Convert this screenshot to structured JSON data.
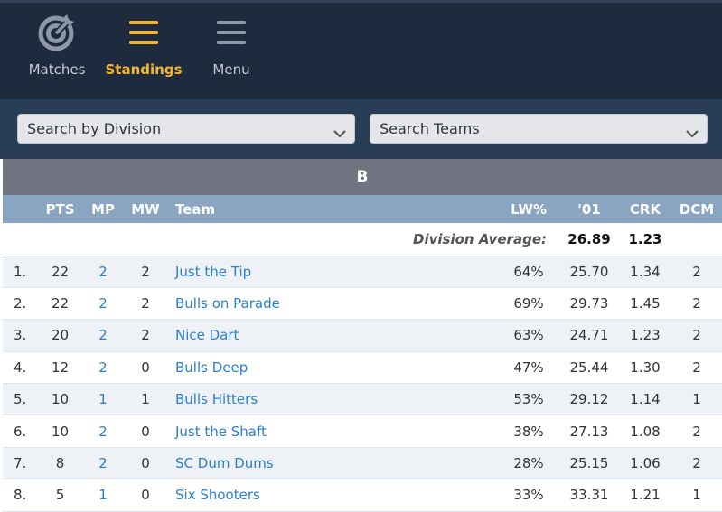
{
  "nav": {
    "items": [
      {
        "label": "Matches",
        "icon": "target-icon",
        "active": false
      },
      {
        "label": "Standings",
        "icon": "hamburger-icon",
        "active": true
      },
      {
        "label": "Menu",
        "icon": "menu-icon",
        "active": false
      }
    ],
    "active_color": "#f5b731"
  },
  "search": {
    "division_placeholder": "Search by Division",
    "teams_placeholder": "Search Teams"
  },
  "division": {
    "name": "B"
  },
  "table": {
    "columns": {
      "rank": "",
      "pts": "PTS",
      "mp": "MP",
      "mw": "MW",
      "team": "Team",
      "lw": "LW%",
      "o1": "'01",
      "crk": "CRK",
      "dcm": "DCM"
    },
    "average": {
      "label": "Division Average:",
      "o1": "26.89",
      "crk": "1.23"
    },
    "rows": [
      {
        "rank": "1.",
        "pts": "22",
        "mp": "2",
        "mw": "2",
        "team": "Just the Tip",
        "lw": "64%",
        "o1": "25.70",
        "crk": "1.34",
        "dcm": "2"
      },
      {
        "rank": "2.",
        "pts": "22",
        "mp": "2",
        "mw": "2",
        "team": "Bulls on Parade",
        "lw": "69%",
        "o1": "29.73",
        "crk": "1.45",
        "dcm": "2"
      },
      {
        "rank": "3.",
        "pts": "20",
        "mp": "2",
        "mw": "2",
        "team": "Nice Dart",
        "lw": "63%",
        "o1": "24.71",
        "crk": "1.23",
        "dcm": "2"
      },
      {
        "rank": "4.",
        "pts": "12",
        "mp": "2",
        "mw": "0",
        "team": "Bulls Deep",
        "lw": "47%",
        "o1": "25.44",
        "crk": "1.30",
        "dcm": "2"
      },
      {
        "rank": "5.",
        "pts": "10",
        "mp": "1",
        "mw": "1",
        "team": "Bulls Hitters",
        "lw": "53%",
        "o1": "29.12",
        "crk": "1.14",
        "dcm": "1"
      },
      {
        "rank": "6.",
        "pts": "10",
        "mp": "2",
        "mw": "0",
        "team": "Just the Shaft",
        "lw": "38%",
        "o1": "27.13",
        "crk": "1.08",
        "dcm": "2"
      },
      {
        "rank": "7.",
        "pts": "8",
        "mp": "2",
        "mw": "0",
        "team": "SC Dum Dums",
        "lw": "28%",
        "o1": "25.15",
        "crk": "1.06",
        "dcm": "2"
      },
      {
        "rank": "8.",
        "pts": "5",
        "mp": "1",
        "mw": "0",
        "team": "Six Shooters",
        "lw": "33%",
        "o1": "33.31",
        "crk": "1.21",
        "dcm": "1"
      }
    ]
  }
}
